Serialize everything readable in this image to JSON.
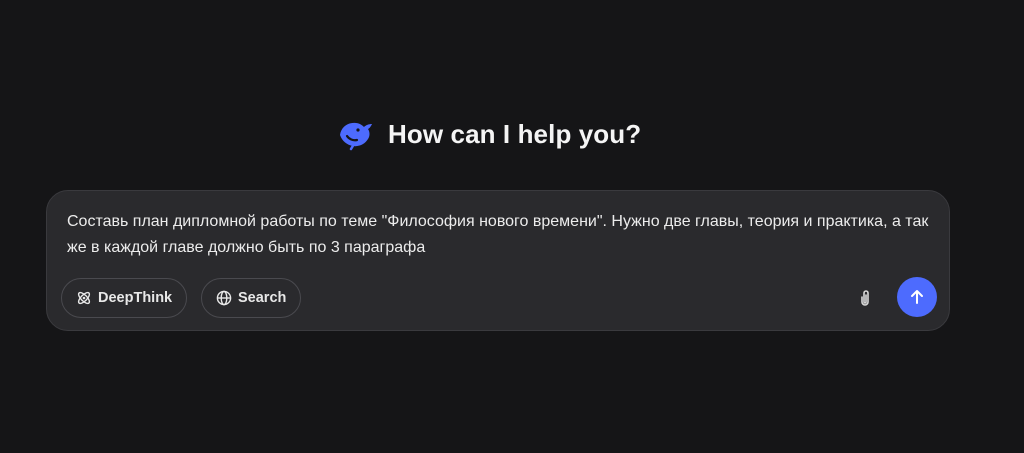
{
  "greeting": {
    "text": "How can I help you?",
    "logo_icon": "deepseek-whale-icon"
  },
  "composer": {
    "input_value": "Составь план дипломной работы по теме \"Философия нового времени\". Нужно две главы, теория и практика, а так же в каждой главе должно быть по 3 параграфа",
    "buttons": {
      "deepthink_label": "DeepThink",
      "deepthink_icon": "atom-icon",
      "search_label": "Search",
      "search_icon": "globe-icon"
    },
    "attach_icon": "paperclip-icon",
    "send_icon": "arrow-up-icon"
  },
  "colors": {
    "background": "#151517",
    "composer_bg": "#2a2a2d",
    "accent": "#4d6bfe",
    "text": "#f2f2f2"
  }
}
